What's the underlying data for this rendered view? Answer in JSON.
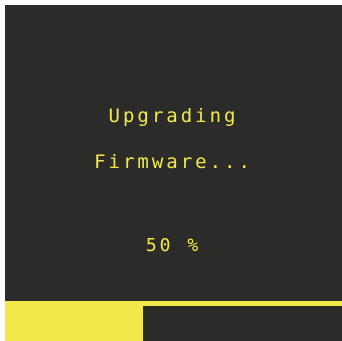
{
  "dialog": {
    "line1": "Upgrading",
    "line2": "Firmware...",
    "percent_text": "50 %"
  },
  "progress": {
    "fraction": 0.41
  },
  "colors": {
    "background": "#2b2c2a",
    "accent": "#f2e84a"
  }
}
